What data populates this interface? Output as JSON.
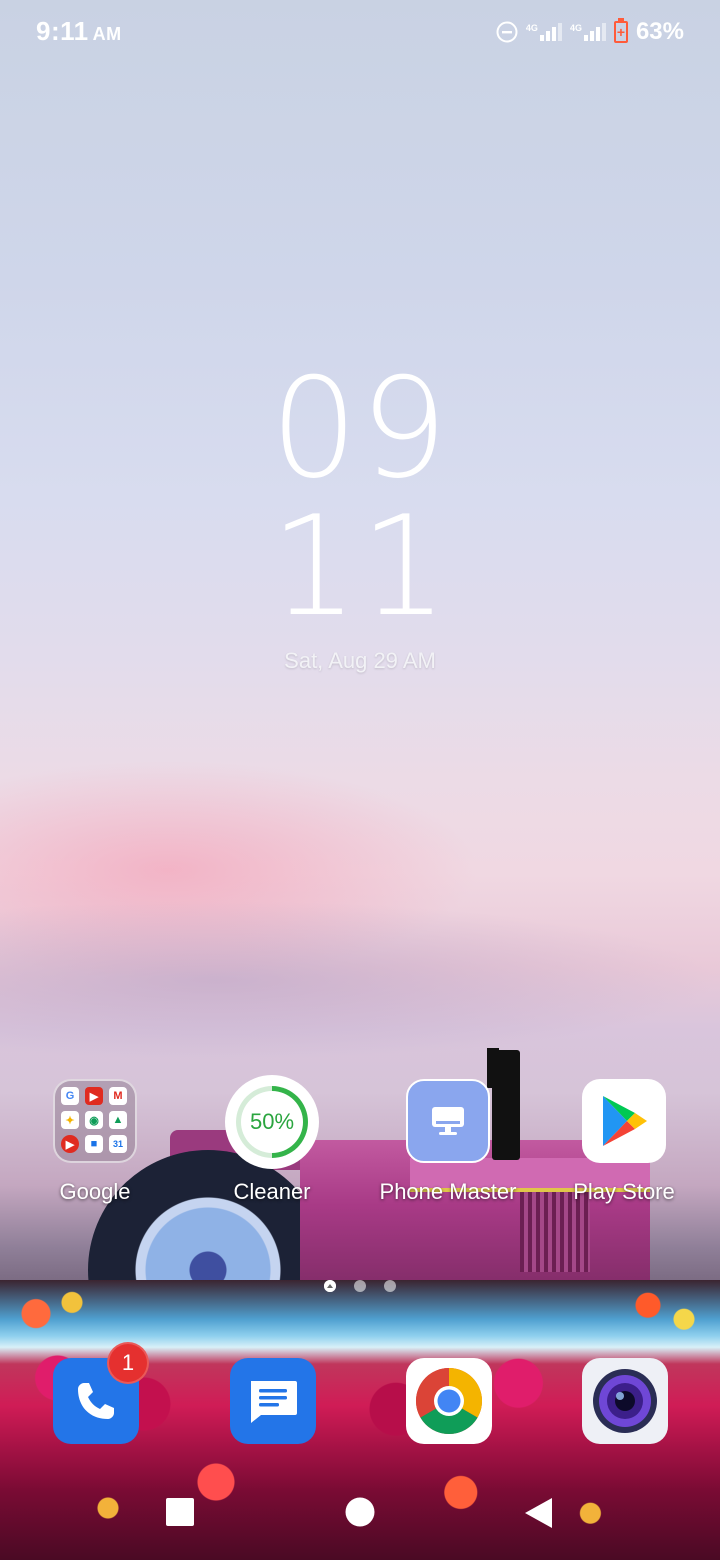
{
  "status_bar": {
    "time": "9:11",
    "ampm": "AM",
    "network_1": "4G",
    "network_2": "4G",
    "battery_percent": "63%",
    "icons": [
      "do-not-disturb-icon",
      "signal-icon",
      "signal-icon",
      "battery-charging-icon"
    ]
  },
  "clock_widget": {
    "hours": "09",
    "minutes": "11",
    "date": "Sat, Aug 29 AM"
  },
  "apps": [
    {
      "label": "Google",
      "icon": "google-folder-icon"
    },
    {
      "label": "Cleaner",
      "icon": "cleaner-icon",
      "value": "50%"
    },
    {
      "label": "Phone Master",
      "icon": "phone-master-icon"
    },
    {
      "label": "Play Store",
      "icon": "play-store-icon"
    }
  ],
  "google_folder": {
    "mini_apps": [
      "G",
      "▶",
      "M",
      "✦",
      "◉",
      "▲",
      "▶",
      "■",
      "31"
    ]
  },
  "pager": {
    "pages": 3,
    "current": 1
  },
  "dock": [
    {
      "name": "phone",
      "icon": "phone-icon",
      "badge": "1"
    },
    {
      "name": "messages",
      "icon": "messages-icon"
    },
    {
      "name": "chrome",
      "icon": "chrome-icon"
    },
    {
      "name": "camera",
      "icon": "camera-icon"
    }
  ],
  "nav": [
    "recents-button",
    "home-button",
    "back-button"
  ],
  "colors": {
    "accent_blue": "#2375e8",
    "badge_red": "#e5302f",
    "cleaner_green": "#34b44a",
    "battery_orange": "#ff5b3a"
  }
}
